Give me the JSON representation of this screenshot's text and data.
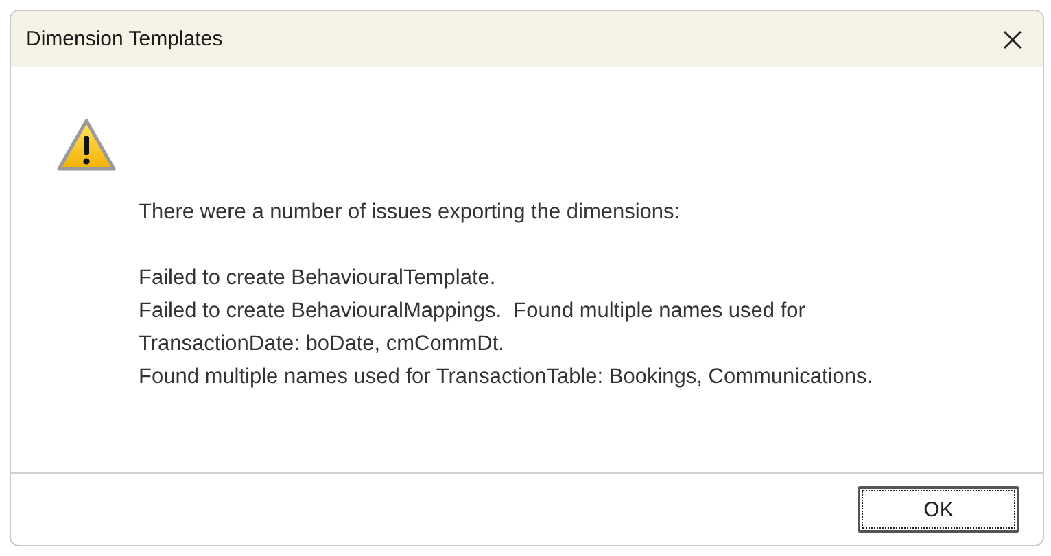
{
  "window": {
    "title": "Dimension Templates"
  },
  "message": {
    "intro": "There were a number of issues exporting the dimensions:",
    "lines": [
      "Failed to create BehaviouralTemplate.",
      "Failed to create BehaviouralMappings.  Found multiple names used for",
      "TransactionDate: boDate, cmCommDt.",
      "Found multiple names used for TransactionTable: Bookings, Communications."
    ]
  },
  "buttons": [
    {
      "label": "OK",
      "focused": true
    }
  ]
}
